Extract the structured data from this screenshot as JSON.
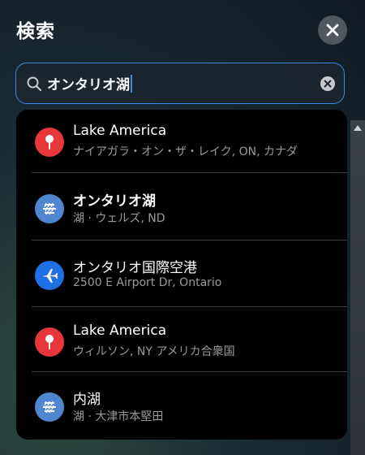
{
  "header": {
    "title": "検索"
  },
  "search": {
    "value": "オンタリオ湖"
  },
  "colors": {
    "accent": "#3d88e0",
    "pin_red": "#e8363d",
    "lake_blue": "#4f86cf",
    "airport_blue": "#1f6fe5"
  },
  "results": [
    {
      "name": "Lake America",
      "subtitle": "ナイアガラ・オン・ザ・レイク, ON, カナダ",
      "icon": "pin-icon"
    },
    {
      "name": "オンタリオ湖",
      "subtitle": "湖 · ウェルズ, ND",
      "icon": "lake-icon"
    },
    {
      "name": "オンタリオ国際空港",
      "subtitle": "2500 E Airport Dr, Ontario",
      "icon": "airplane-icon"
    },
    {
      "name": "Lake America",
      "subtitle": "ウィルソン, NY アメリカ合衆国",
      "icon": "pin-icon"
    },
    {
      "name": "内湖",
      "subtitle": "湖 · 大津市本堅田",
      "icon": "lake-icon"
    }
  ]
}
